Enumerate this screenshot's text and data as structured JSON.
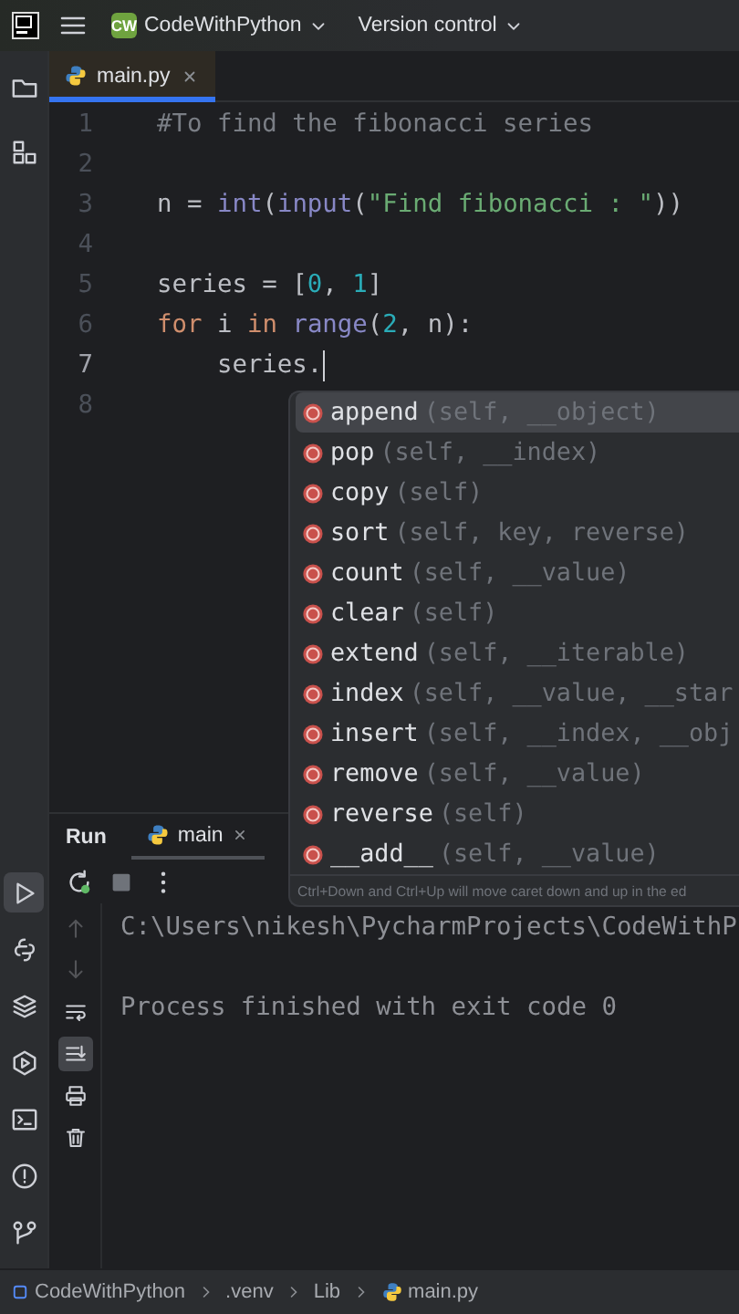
{
  "top_bar": {
    "project": {
      "badge": "CW",
      "name": "CodeWithPython"
    },
    "vcs": "Version control"
  },
  "side_strip": {
    "top": [
      {
        "kind": "folder",
        "selected": false
      },
      {
        "kind": "structure",
        "selected": false
      }
    ],
    "bottom": [
      {
        "kind": "run",
        "selected": true
      },
      {
        "kind": "console",
        "selected": false
      },
      {
        "kind": "layers",
        "selected": false
      },
      {
        "kind": "services",
        "selected": false
      },
      {
        "kind": "terminal",
        "selected": false
      },
      {
        "kind": "problems",
        "selected": false
      },
      {
        "kind": "git",
        "selected": false
      }
    ]
  },
  "editor": {
    "tabs": [
      {
        "label": "main.py",
        "selected": true
      }
    ],
    "lines": [
      {
        "number": "1",
        "current": false,
        "tokens": [
          {
            "kind": "comment",
            "text": "#To find the fibonacci series"
          }
        ]
      },
      {
        "number": "2",
        "current": false
      },
      {
        "number": "3",
        "current": false,
        "tokens": [
          {
            "kind": "plain",
            "text": "n = "
          },
          {
            "kind": "builtin",
            "text": "int"
          },
          {
            "kind": "plain",
            "text": "("
          },
          {
            "kind": "builtin",
            "text": "input"
          },
          {
            "kind": "plain",
            "text": "("
          },
          {
            "kind": "string",
            "text": "\"Find fibonacci : \""
          },
          {
            "kind": "plain",
            "text": "))"
          }
        ]
      },
      {
        "number": "4",
        "current": false
      },
      {
        "number": "5",
        "current": false,
        "tokens": [
          {
            "kind": "plain",
            "text": "series = ["
          },
          {
            "kind": "number",
            "text": "0"
          },
          {
            "kind": "plain",
            "text": ", "
          },
          {
            "kind": "number",
            "text": "1"
          },
          {
            "kind": "plain",
            "text": "]"
          }
        ]
      },
      {
        "number": "6",
        "current": false,
        "tokens": [
          {
            "kind": "keyword",
            "text": "for"
          },
          {
            "kind": "plain",
            "text": " i "
          },
          {
            "kind": "keyword",
            "text": "in "
          },
          {
            "kind": "builtin",
            "text": "range"
          },
          {
            "kind": "plain",
            "text": "("
          },
          {
            "kind": "number",
            "text": "2"
          },
          {
            "kind": "plain",
            "text": ", n):"
          }
        ]
      },
      {
        "number": "7",
        "current": true,
        "tokens": [
          {
            "kind": "plain",
            "text": "    series."
          }
        ]
      },
      {
        "number": "8",
        "current": false
      }
    ]
  },
  "completion": {
    "items": [
      {
        "name": "append",
        "params": "(self, __object)",
        "selected": true
      },
      {
        "name": "pop",
        "params": "(self, __index)",
        "selected": false
      },
      {
        "name": "copy",
        "params": "(self)",
        "selected": false
      },
      {
        "name": "sort",
        "params": "(self, key, reverse)",
        "selected": false
      },
      {
        "name": "count",
        "params": "(self, __value)",
        "selected": false
      },
      {
        "name": "clear",
        "params": "(self)",
        "selected": false
      },
      {
        "name": "extend",
        "params": "(self, __iterable)",
        "selected": false
      },
      {
        "name": "index",
        "params": "(self, __value, __star",
        "selected": false
      },
      {
        "name": "insert",
        "params": "(self, __index, __obj",
        "selected": false
      },
      {
        "name": "remove",
        "params": "(self, __value)",
        "selected": false
      },
      {
        "name": "reverse",
        "params": "(self)",
        "selected": false
      },
      {
        "name": "__add__",
        "params": "(self, __value)",
        "selected": false
      }
    ],
    "hint": "Ctrl+Down and Ctrl+Up will move caret down and up in the ed"
  },
  "run": {
    "title": "Run",
    "tabs": [
      {
        "label": "main",
        "selected": true
      }
    ],
    "toolbar": [
      {
        "kind": "rerun"
      },
      {
        "kind": "stop"
      },
      {
        "kind": "more"
      }
    ],
    "side_tools": [
      {
        "kind": "up",
        "disabled": true,
        "on": false
      },
      {
        "kind": "down",
        "disabled": true,
        "on": false
      },
      {
        "kind": "wrap",
        "disabled": false,
        "on": false
      },
      {
        "kind": "scroll-end",
        "disabled": false,
        "on": true
      },
      {
        "kind": "print",
        "disabled": false,
        "on": false
      },
      {
        "kind": "trash",
        "disabled": false,
        "on": false
      }
    ],
    "output": [
      "C:\\Users\\nikesh\\PycharmProjects\\CodeWithP",
      "Process finished with exit code 0"
    ]
  },
  "breadcrumbs": [
    {
      "kind": "module",
      "label": "CodeWithPython"
    },
    {
      "kind": "folder",
      "label": ".venv"
    },
    {
      "kind": "folder",
      "label": "Lib"
    },
    {
      "kind": "python",
      "label": "main.py"
    }
  ]
}
